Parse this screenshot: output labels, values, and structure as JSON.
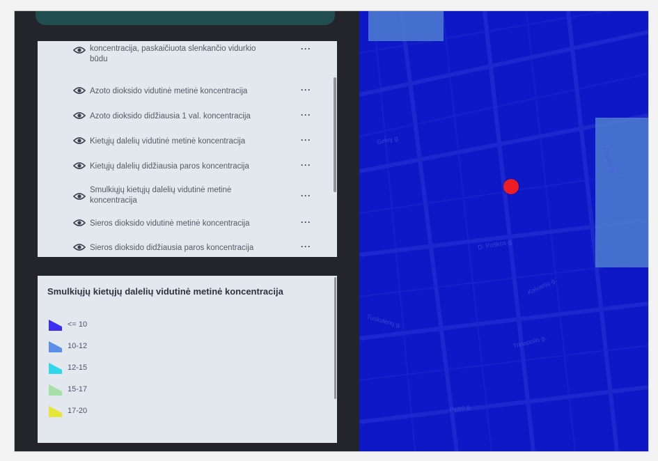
{
  "layers": {
    "items": [
      {
        "label": "koncentracija, paskaičiuota slenkančio vidurkio būdu",
        "more": "···"
      },
      {
        "label": "Azoto dioksido vidutinė metinė koncentracija",
        "more": "···"
      },
      {
        "label": "Azoto dioksido didžiausia 1 val. koncentracija",
        "more": "···"
      },
      {
        "label": "Kietųjų dalelių vidutinė metinė koncentracija",
        "more": "···"
      },
      {
        "label": "Kietųjų dalelių didžiausia paros koncentracija",
        "more": "···"
      },
      {
        "label": "Smulkiųjų kietųjų dalelių vidutinė metinė koncentracija",
        "more": "···"
      },
      {
        "label": "Sieros dioksido vidutinė metinė koncentracija",
        "more": "···"
      },
      {
        "label": "Sieros dioksido didžiausia paros koncentracija",
        "more": "···"
      }
    ]
  },
  "legend": {
    "title": "Smulkiųjų kietųjų dalelių vidutinė metinė koncentracija",
    "items": [
      {
        "label": "<= 10",
        "color": "#3a2ff0"
      },
      {
        "label": "10-12",
        "color": "#5b8ee6"
      },
      {
        "label": "12-15",
        "color": "#2fd8e8"
      },
      {
        "label": "15-17",
        "color": "#a6e0a6"
      },
      {
        "label": "17-20",
        "color": "#e6e636"
      }
    ]
  },
  "map": {
    "background": "#0e18c6",
    "marker_color": "#ee1c25",
    "street_labels": [
      "Gelvy g.",
      "Olandų g.",
      "D. Poškos g.",
      "Kalvarijų g.",
      "Tuskulėnų g.",
      "Trinapolio g.",
      "Petro g."
    ]
  }
}
